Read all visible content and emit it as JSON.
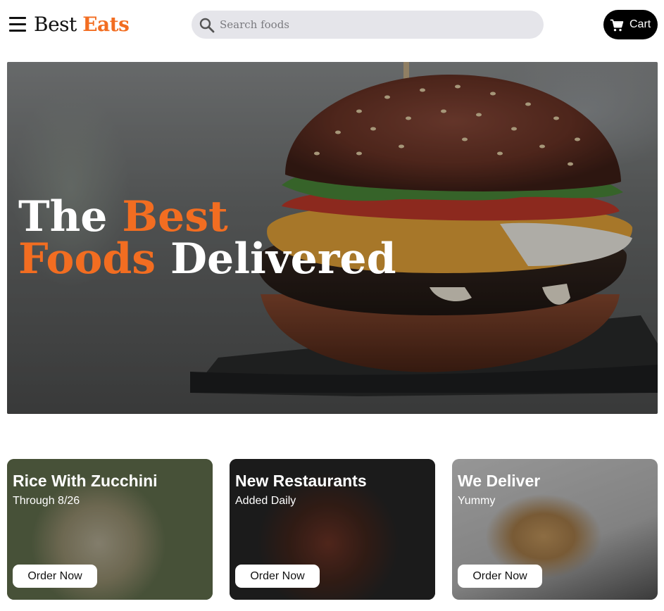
{
  "header": {
    "logo_primary": "Best",
    "logo_accent": "Eats",
    "search_placeholder": "Search foods",
    "cart_label": "Cart"
  },
  "hero": {
    "title_line1_a": "The",
    "title_line1_b": "Best",
    "title_line2_a": "Foods",
    "title_line2_b": "Delivered"
  },
  "cards": [
    {
      "title": "Rice With Zucchini",
      "subtitle": "Through 8/26",
      "button": "Order Now"
    },
    {
      "title": "New Restaurants",
      "subtitle": "Added Daily",
      "button": "Order Now"
    },
    {
      "title": "We Deliver",
      "subtitle": "Yummy",
      "button": "Order Now"
    }
  ],
  "colors": {
    "accent": "#f26d21",
    "cart_bg": "#000000",
    "search_bg": "#e5e5ea"
  },
  "icons": {
    "menu": "menu-icon",
    "search": "search-icon",
    "cart": "cart-icon"
  }
}
